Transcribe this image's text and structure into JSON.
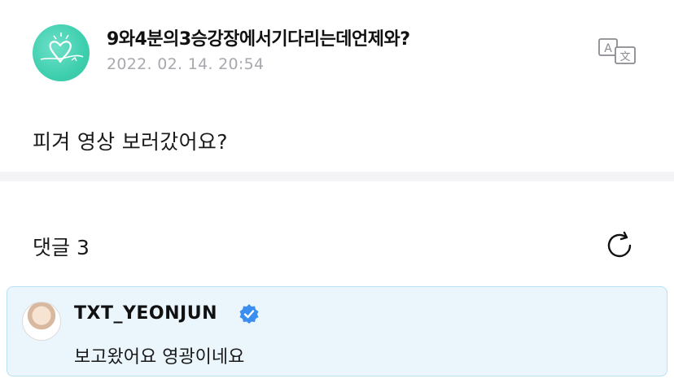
{
  "post": {
    "author_name": "9와4분의3승강장에서기다리는데언제와?",
    "date": "2022. 02. 14. 20:54",
    "body": "피겨 영상 보러갔어요?",
    "translate_icon": "translate-icon"
  },
  "comments": {
    "title": "댓글 3",
    "refresh_icon": "refresh-icon",
    "items": [
      {
        "author": "TXT_YEONJUN",
        "verified": true,
        "text": "보고왔어요 영광이네요"
      }
    ]
  },
  "colors": {
    "avatar_teal": "#3ecfae",
    "date_gray": "#a8a8ae",
    "card_bg": "#eaf5fc",
    "card_border": "#b9e0f4",
    "verified_blue": "#3b8ef0"
  }
}
